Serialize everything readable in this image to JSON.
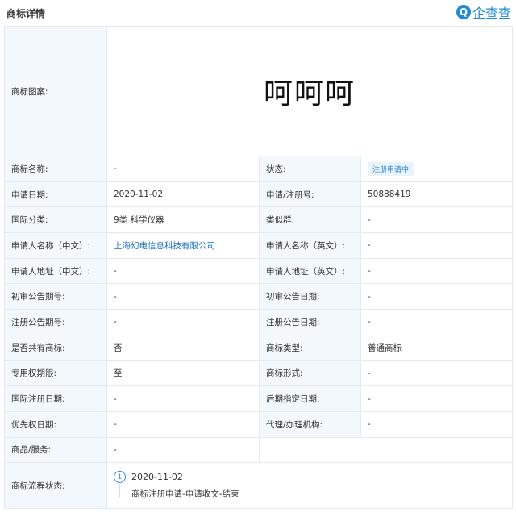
{
  "header": {
    "title": "商标详情",
    "logo_text": "企查查",
    "logo_icon": "qichacha-logo-icon"
  },
  "mark": {
    "label": "商标图案:",
    "text": "呵呵呵"
  },
  "rows": [
    {
      "l1": "商标名称:",
      "v1": "-",
      "l2": "状态:",
      "v2": "注册申请中"
    },
    {
      "l1": "申请日期:",
      "v1": "2020-11-02",
      "l2": "申请/注册号:",
      "v2": "50888419"
    },
    {
      "l1": "国际分类:",
      "v1": "9类 科学仪器",
      "l2": "类似群:",
      "v2": "-"
    },
    {
      "l1": "申请人名称（中文）:",
      "v1": "上海幻电信息科技有限公司",
      "l2": "申请人名称（英文）:",
      "v2": "-"
    },
    {
      "l1": "申请人地址（中文）:",
      "v1": "-",
      "l2": "申请人地址（英文）:",
      "v2": "-"
    },
    {
      "l1": "初审公告期号:",
      "v1": "-",
      "l2": "初审公告日期:",
      "v2": "-"
    },
    {
      "l1": "注册公告期号:",
      "v1": "-",
      "l2": "注册公告日期:",
      "v2": "-"
    },
    {
      "l1": "是否共有商标:",
      "v1": "否",
      "l2": "商标类型:",
      "v2": "普通商标"
    },
    {
      "l1": "专用权期限:",
      "v1": "至",
      "l2": "商标形式:",
      "v2": "-"
    },
    {
      "l1": "国际注册日期:",
      "v1": "-",
      "l2": "后期指定日期:",
      "v2": "-"
    },
    {
      "l1": "优先权日期:",
      "v1": "-",
      "l2": "代理/办理机构:",
      "v2": "-"
    }
  ],
  "goods": {
    "label": "商品/服务:",
    "value": "-"
  },
  "flow": {
    "label": "商标流程状态:",
    "step_number": "1",
    "date": "2020-11-02",
    "description": "商标注册申请-申请收文-结束"
  },
  "colors": {
    "label_bg": "#f2f8fc",
    "border": "#e6ebf0",
    "accent": "#1e8bd8",
    "link": "#1e6fc5"
  }
}
